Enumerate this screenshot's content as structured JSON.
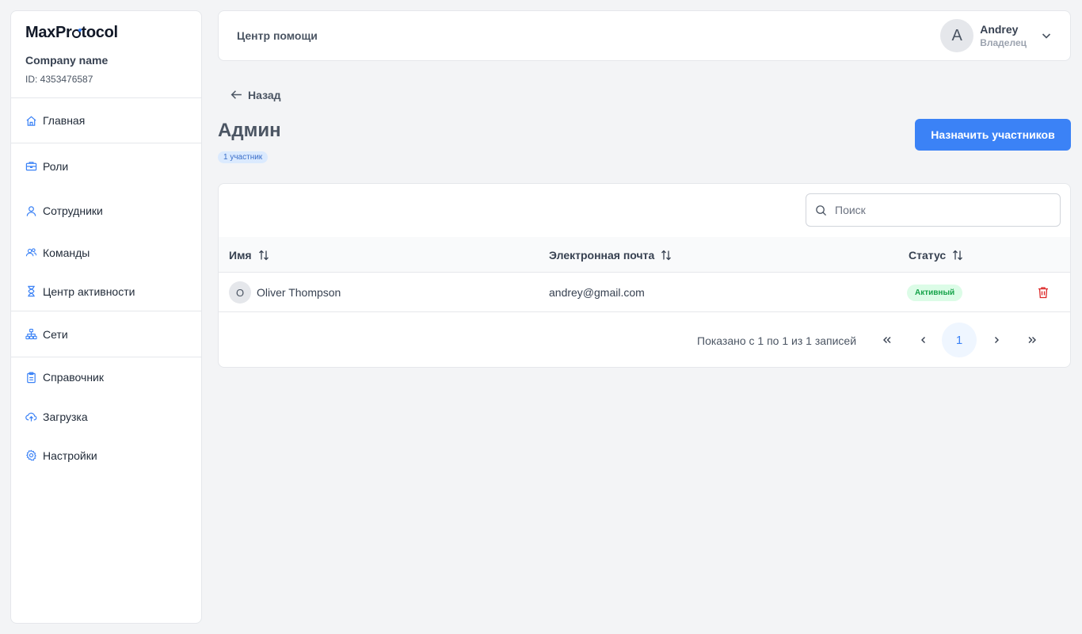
{
  "brand": {
    "logo_pre": "MaxPr",
    "logo_post": "tocol",
    "company": "Company name",
    "company_id": "ID: 4353476587"
  },
  "sidebar": {
    "items": [
      {
        "label": "Главная",
        "icon": "home-icon"
      },
      {
        "label": "Роли",
        "icon": "briefcase-icon"
      },
      {
        "label": "Сотрудники",
        "icon": "user-icon"
      },
      {
        "label": "Команды",
        "icon": "users-icon"
      },
      {
        "label": "Центр активности",
        "icon": "hourglass-icon"
      },
      {
        "label": "Сети",
        "icon": "network-icon"
      },
      {
        "label": "Справочник",
        "icon": "clipboard-icon"
      },
      {
        "label": "Загрузка",
        "icon": "cloud-upload-icon"
      },
      {
        "label": "Настройки",
        "icon": "gear-icon"
      }
    ]
  },
  "header": {
    "help": "Центр помощи",
    "user_initial": "A",
    "user_name": "Andrey",
    "user_role": "Владелец"
  },
  "page": {
    "back": "Назад",
    "title": "Админ",
    "badge": "1 участник",
    "assign_button": "Назначить участников"
  },
  "table": {
    "search_placeholder": "Поиск",
    "columns": [
      "Имя",
      "Электронная почта",
      "Статус"
    ],
    "rows": [
      {
        "initial": "O",
        "name": "Oliver Thompson",
        "email": "andrey@gmail.com",
        "status": "Активный"
      }
    ]
  },
  "pagination": {
    "info": "Показано с 1 по 1 из 1 записей",
    "current_page": "1"
  },
  "colors": {
    "accent": "#3b82f6",
    "active_status": "#16a34a",
    "delete": "#dc2626"
  }
}
